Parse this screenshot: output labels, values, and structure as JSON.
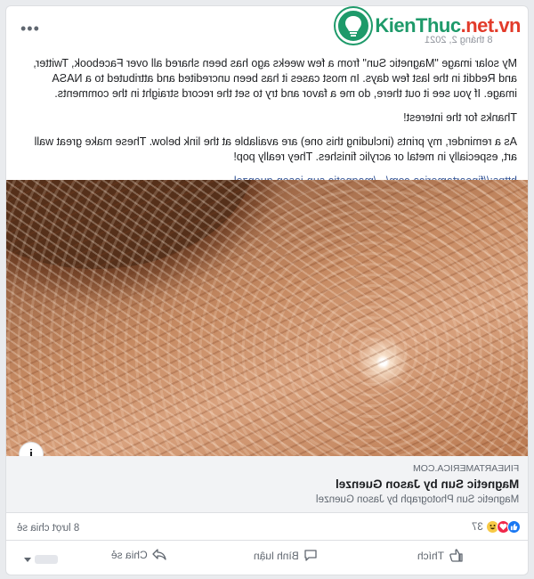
{
  "header": {
    "more_label": "•••",
    "date": "8 tháng 2, 2021",
    "brand_name_main": "KienThuc",
    "brand_name_dot": ".net.vn"
  },
  "post": {
    "paragraphs": [
      "My solar image \"Magnetic Sun\" from a few weeks ago has been shared all over Facebook, Twitter, and Reddit in the last few days.  In most cases it has been uncredited and attributed to a NASA image.  If you see it out there, do me a favor and try to set the record straight in the comments.",
      "Thanks for the interest!",
      "As a reminder, my prints (including this one) are available at the link below.  These make great wall art, especially in metal or acrylic finishes.  They really pop!"
    ],
    "link_text": "https://fineartamerica.com/.../magnetic-sun-jason-guenzel..."
  },
  "photo": {
    "info_label": "i"
  },
  "link_preview": {
    "domain": "FINEARTAMERICA.COM",
    "title": "Magnetic Sun by Jason Guenzel",
    "description": "Magnetic Sun Photograph by Jason Guenzel"
  },
  "stats": {
    "reaction_count": "37",
    "shares": "8 lượt chia sẻ",
    "reaction_icons": [
      "haha-icon",
      "love-icon",
      "like-icon"
    ]
  },
  "actions": {
    "like": "Thích",
    "comment": "Bình luận",
    "share": "Chia sẻ"
  },
  "colors": {
    "link": "#385898",
    "brand": "#1e9a6a",
    "like_blue": "#1877f2"
  }
}
